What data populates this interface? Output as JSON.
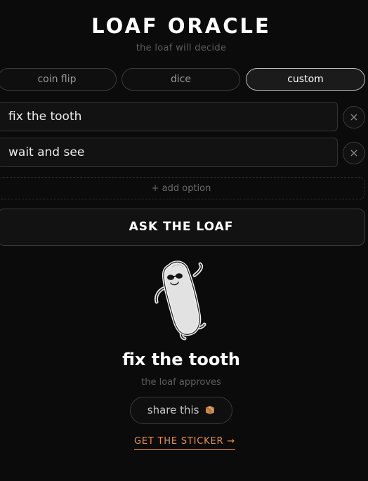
{
  "header": {
    "title": "LOAF ORACLE",
    "subtitle": "the loaf will decide"
  },
  "mode_tabs": [
    {
      "label": "coin flip",
      "active": false
    },
    {
      "label": "dice",
      "active": false
    },
    {
      "label": "custom",
      "active": true
    }
  ],
  "options": [
    {
      "text": "fix the tooth",
      "remove_icon": "×"
    },
    {
      "text": "wait and see",
      "remove_icon": "×"
    }
  ],
  "add_option_label": "+ add option",
  "ask_button_label": "ASK THE LOAF",
  "result": {
    "mascot_icon": "loaf-with-sunglasses",
    "answer": "fix the tooth",
    "verdict": "the loaf approves"
  },
  "share_label": "share this",
  "share_icon": "package-box-icon",
  "sticker_link_label": "GET THE STICKER →",
  "colors": {
    "background": "#0b0b0b",
    "accent": "#e7904f",
    "border": "#3a3a3a"
  }
}
